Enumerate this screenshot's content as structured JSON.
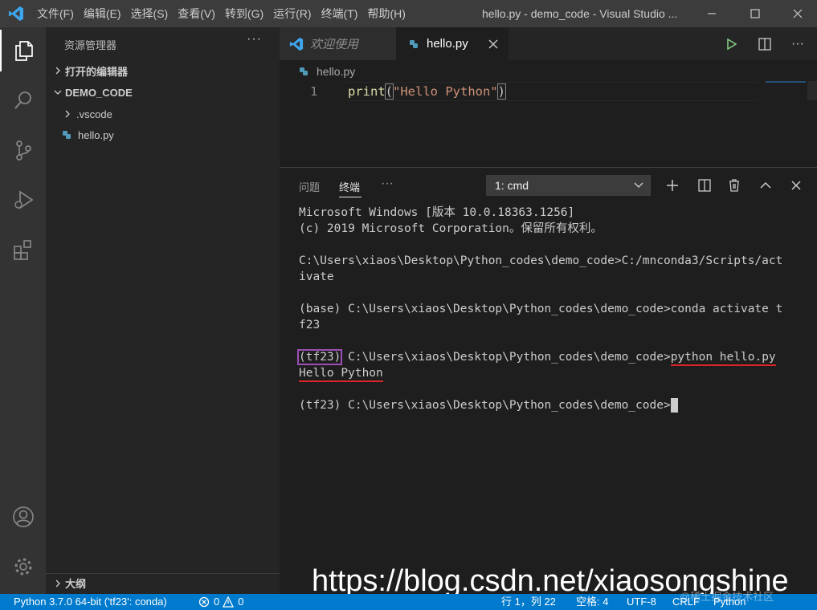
{
  "titlebar": {
    "menu": [
      "文件(F)",
      "编辑(E)",
      "选择(S)",
      "查看(V)",
      "转到(G)",
      "运行(R)",
      "终端(T)",
      "帮助(H)"
    ],
    "window_title": "hello.py - demo_code - Visual Studio ..."
  },
  "sidebar": {
    "title": "资源管理器",
    "more": "···",
    "open_editors": "打开的编辑器",
    "folder": "DEMO_CODE",
    "items": [
      ".vscode",
      "hello.py"
    ],
    "outline": "大纲"
  },
  "editor": {
    "tabs": [
      "欢迎使用",
      "hello.py"
    ],
    "breadcrumb": "hello.py",
    "line_number": "1",
    "code": {
      "fn": "print",
      "open": "(",
      "string": "\"Hello Python\"",
      "close": ")"
    }
  },
  "panel": {
    "tabs": [
      "问题",
      "终端",
      "···"
    ],
    "terminal_select": "1: cmd",
    "lines": [
      "Microsoft Windows [版本 10.0.18363.1256]",
      "(c) 2019 Microsoft Corporation。保留所有权利。",
      "",
      "C:\\Users\\xiaos\\Desktop\\Python_codes\\demo_code>C:/mnconda3/Scripts/act",
      "ivate",
      "",
      "(base) C:\\Users\\xiaos\\Desktop\\Python_codes\\demo_code>conda activate t",
      "f23",
      ""
    ],
    "env_prefix": "(tf23)",
    "run_path": " C:\\Users\\xiaos\\Desktop\\Python_codes\\demo_code>",
    "run_cmd": "python hello.py",
    "output": "Hello Python",
    "prompt": "(tf23) C:\\Users\\xiaos\\Desktop\\Python_codes\\demo_code>"
  },
  "watermark": "https://blog.csdn.net/xiaosongshine",
  "watermark_small": "@稀土掘金技术社区",
  "statusbar": {
    "interpreter": "Python 3.7.0 64-bit ('tf23': conda)",
    "errors": "0",
    "warnings": "0",
    "position": "行 1，列 22",
    "spaces": "空格: 4",
    "encoding": "UTF-8",
    "eol": "CRLF",
    "language": "Python"
  },
  "colors": {
    "accent": "#007acc",
    "string": "#ce9178",
    "function": "#dcdcaa",
    "highlight_box": "#9c4fb7",
    "underline": "#d9262b"
  }
}
